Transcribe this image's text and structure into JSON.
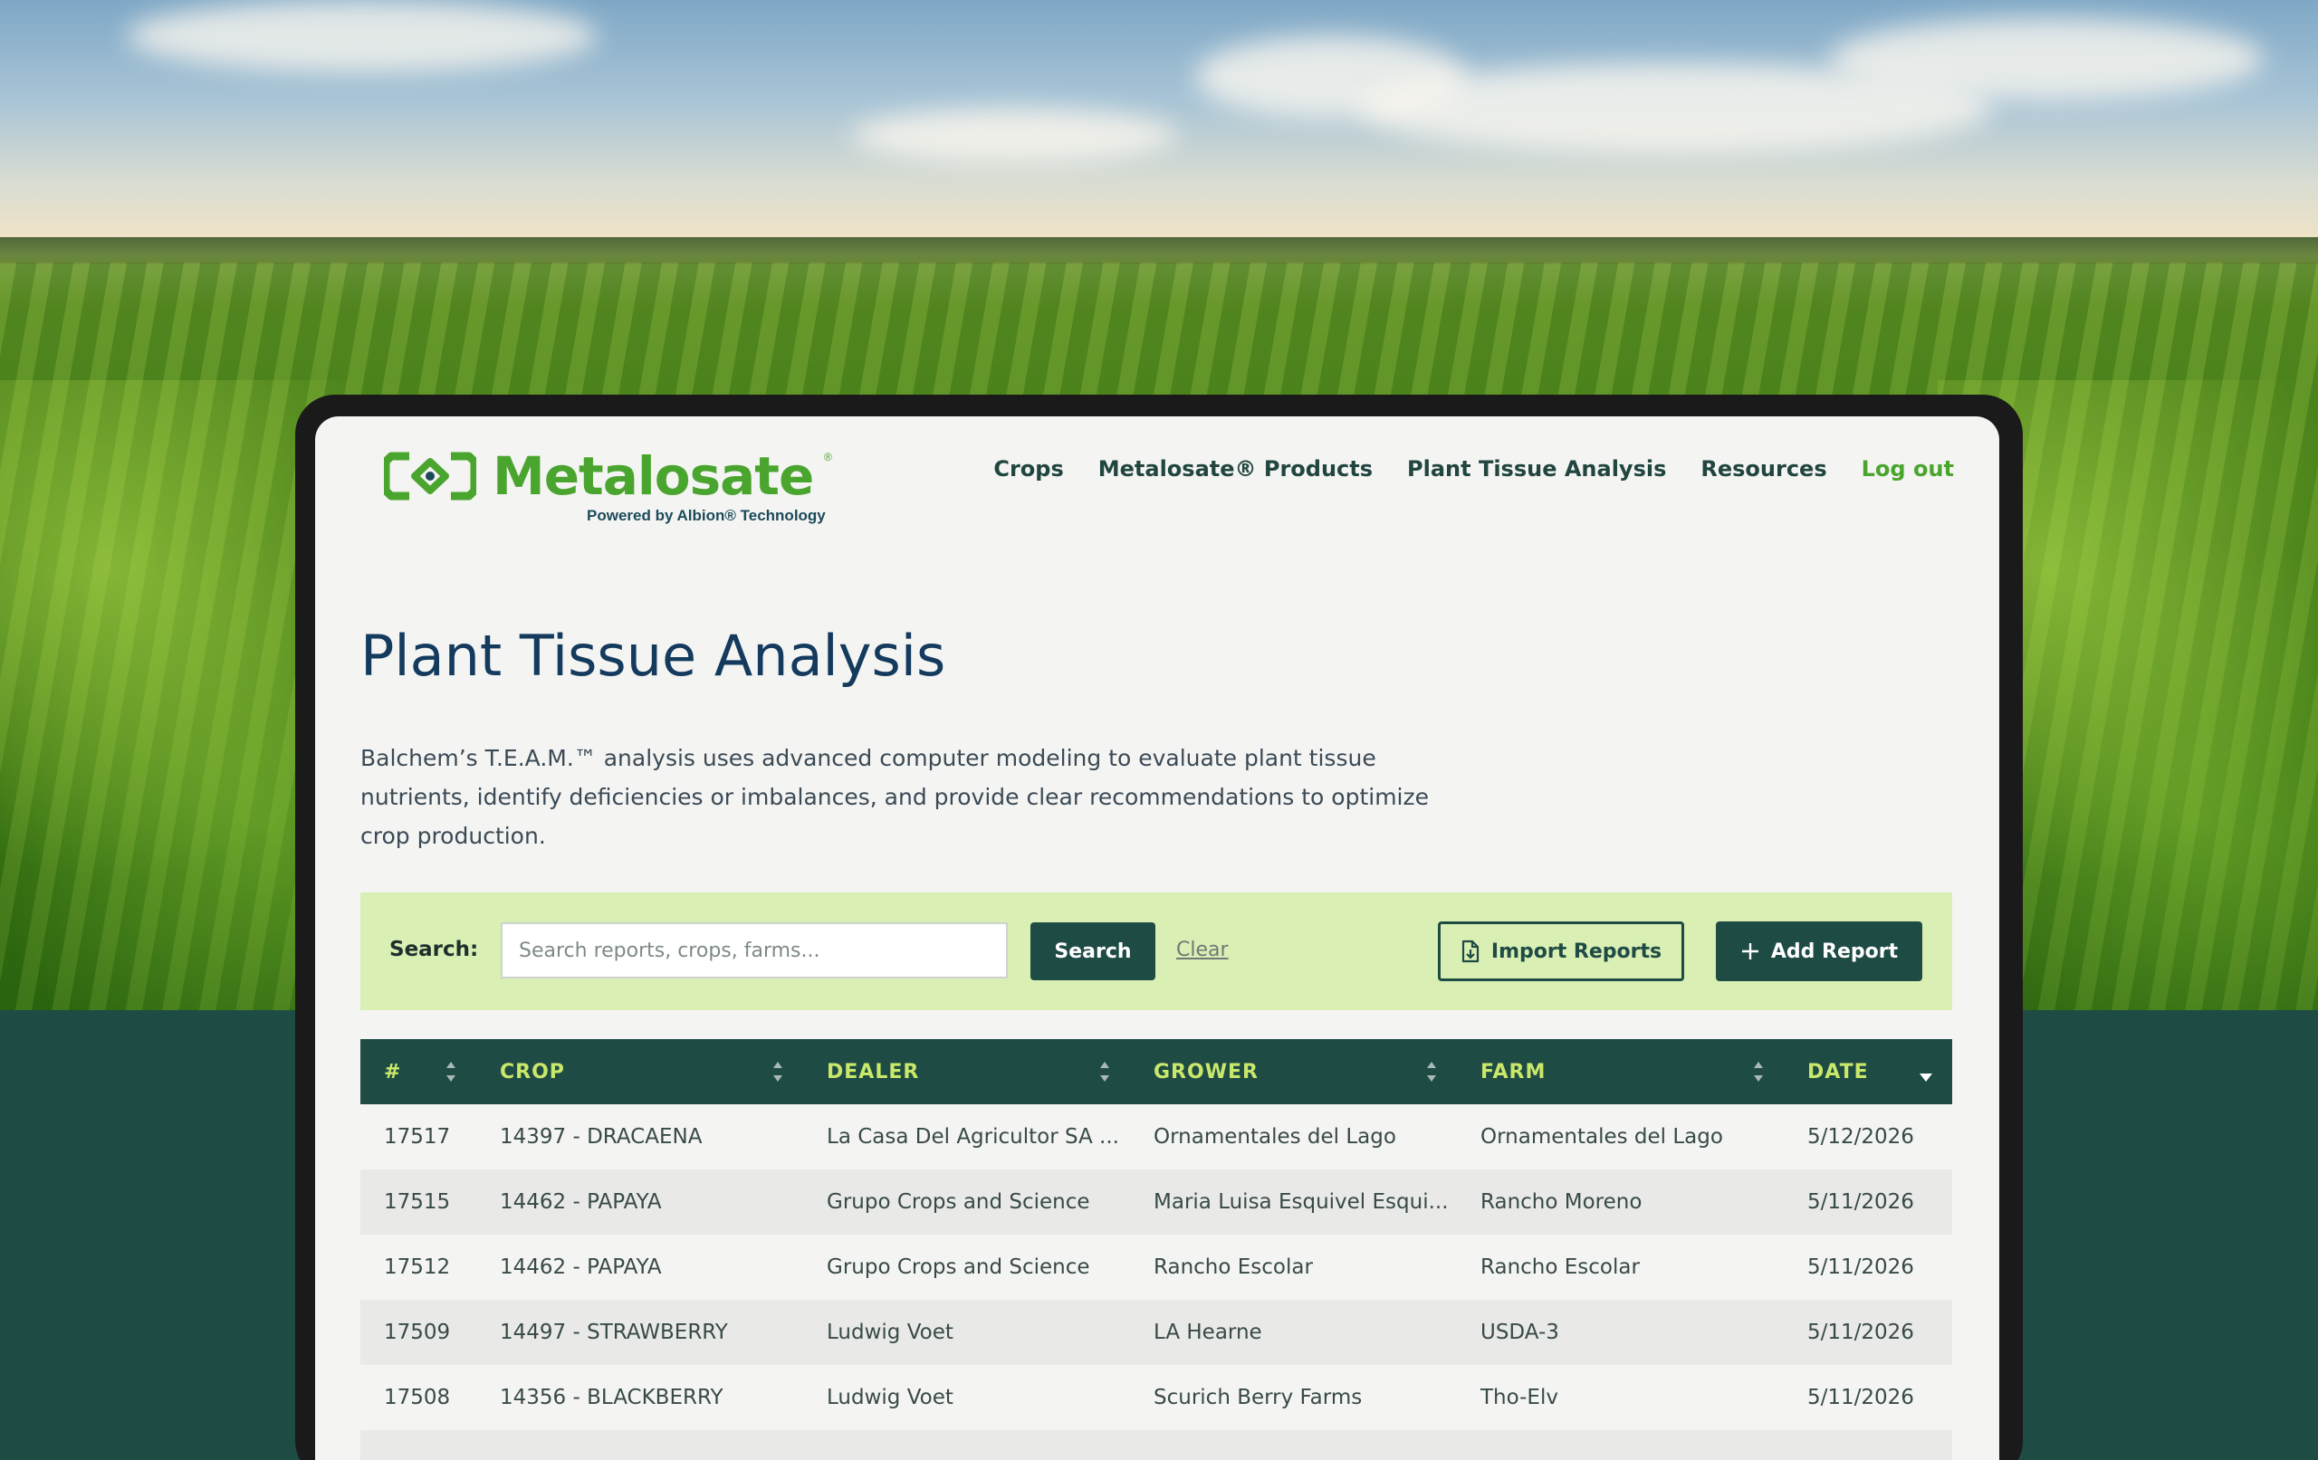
{
  "brand": {
    "name": "Metalosate",
    "registered": "®",
    "tagline": "Powered by Albion® Technology",
    "color": "#4aa52e",
    "dark": "#1f4b45"
  },
  "nav": {
    "items": [
      {
        "label": "Crops"
      },
      {
        "label": "Metalosate® Products"
      },
      {
        "label": "Plant Tissue Analysis"
      },
      {
        "label": "Resources"
      }
    ],
    "logout": "Log out"
  },
  "page": {
    "title": "Plant Tissue Analysis",
    "description": "Balchem’s T.E.A.M.™ analysis uses advanced computer modeling to evaluate plant tissue nutrients, identify deficiencies or imbalances, and provide clear recommendations to optimize crop production."
  },
  "search": {
    "label": "Search:",
    "placeholder": "Search reports, crops, farms...",
    "value": "",
    "button": "Search",
    "clear": "Clear",
    "import_button": "Import Reports",
    "add_button": "Add Report"
  },
  "table": {
    "columns": [
      "#",
      "CROP",
      "DEALER",
      "GROWER",
      "FARM",
      "DATE"
    ],
    "sorted_column": "DATE",
    "rows": [
      [
        "17517",
        "14397 - DRACAENA",
        "La Casa Del Agricultor SA ...",
        "Ornamentales del Lago",
        "Ornamentales del Lago",
        "5/12/2026"
      ],
      [
        "17515",
        "14462 - PAPAYA",
        "Grupo Crops and Science",
        "Maria Luisa Esquivel Esqui...",
        "Rancho Moreno",
        "5/11/2026"
      ],
      [
        "17512",
        "14462 - PAPAYA",
        "Grupo Crops and Science",
        "Rancho Escolar",
        "Rancho Escolar",
        "5/11/2026"
      ],
      [
        "17509",
        "14497 - STRAWBERRY",
        "Ludwig Voet",
        "LA Hearne",
        "USDA-3",
        "5/11/2026"
      ],
      [
        "17508",
        "14356 - BLACKBERRY",
        "Ludwig Voet",
        "Scurich Berry Farms",
        "Tho-Elv",
        "5/11/2026"
      ]
    ]
  },
  "icons": {
    "import": "file-import-icon",
    "add": "plus-icon",
    "sort": "sort-icon",
    "sort_desc": "sort-desc-icon",
    "logo": "metalosate-logo-icon"
  }
}
